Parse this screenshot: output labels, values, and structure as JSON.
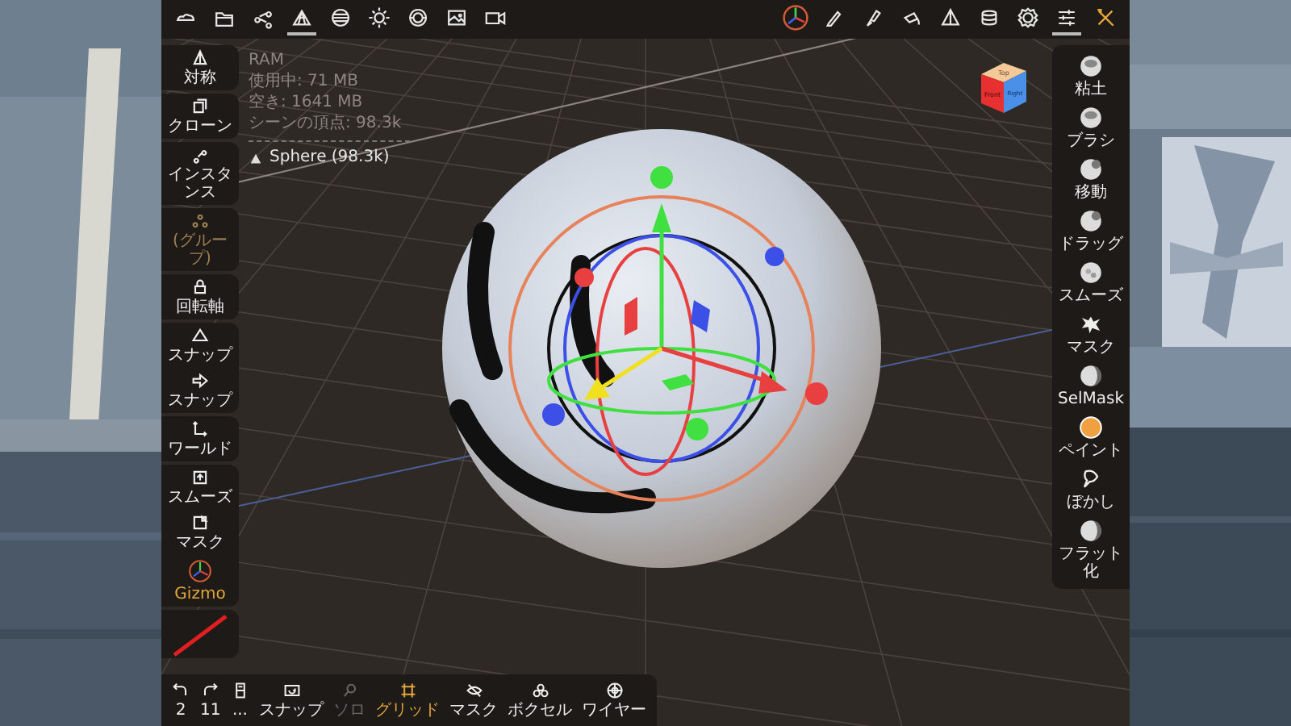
{
  "top_bar": {
    "left_icons": [
      {
        "selected": false
      },
      {
        "selected": false
      },
      {
        "selected": false
      },
      {
        "selected": true
      },
      {
        "selected": false
      },
      {
        "selected": false
      },
      {
        "selected": false
      },
      {
        "selected": false
      },
      {
        "selected": false
      }
    ],
    "right_icons": [
      {
        "selected": false,
        "highlighted": false
      },
      {
        "selected": false,
        "highlighted": false
      },
      {
        "selected": false,
        "highlighted": false
      },
      {
        "selected": false,
        "highlighted": false
      },
      {
        "selected": false,
        "highlighted": false
      },
      {
        "selected": false,
        "highlighted": false
      },
      {
        "selected": false,
        "highlighted": false
      },
      {
        "selected": true,
        "highlighted": false
      },
      {
        "selected": false,
        "highlighted": true
      }
    ]
  },
  "info": {
    "title": "RAM",
    "lines": [
      "使用中: 71 MB",
      "空き: 1641 MB",
      "シーンの頂点: 98.3k"
    ],
    "object": "Sphere (98.3k)"
  },
  "view_cube": {
    "top": "Top",
    "front": "Front",
    "right": "Right"
  },
  "left_toolbar": {
    "groups": [
      {
        "items": [
          {
            "label": "対称",
            "disabled": false,
            "highlighted": false
          }
        ]
      },
      {
        "items": [
          {
            "label": "クローン",
            "disabled": false,
            "highlighted": false
          }
        ]
      },
      {
        "items": [
          {
            "label": "インスタンス",
            "disabled": false,
            "highlighted": false
          }
        ]
      },
      {
        "items": [
          {
            "label": "(グループ)",
            "disabled": true,
            "highlighted": false
          }
        ]
      },
      {
        "items": [
          {
            "label": "回転軸",
            "disabled": false,
            "highlighted": false
          }
        ]
      },
      {
        "items": [
          {
            "label": "スナップ",
            "disabled": false,
            "highlighted": false
          },
          {
            "label": "スナップ",
            "disabled": false,
            "highlighted": false
          }
        ]
      },
      {
        "items": [
          {
            "label": "ワールド",
            "disabled": false,
            "highlighted": false
          }
        ]
      },
      {
        "items": [
          {
            "label": "スムーズ",
            "disabled": false,
            "highlighted": false
          },
          {
            "label": "マスク",
            "disabled": false,
            "highlighted": false
          },
          {
            "label": "Gizmo",
            "disabled": false,
            "highlighted": true
          }
        ]
      }
    ]
  },
  "right_toolbar": {
    "items": [
      {
        "label": "粘土"
      },
      {
        "label": "ブラシ"
      },
      {
        "label": "移動"
      },
      {
        "label": "ドラッグ"
      },
      {
        "label": "スムーズ"
      },
      {
        "label": "マスク"
      },
      {
        "label": "SelMask"
      },
      {
        "label": "ペイント"
      },
      {
        "label": "ぼかし"
      },
      {
        "label": "フラット化"
      }
    ]
  },
  "bottom_bar": {
    "items": [
      {
        "label": "2",
        "disabled": false,
        "active": false
      },
      {
        "label": "11",
        "disabled": false,
        "active": false
      },
      {
        "label": "...",
        "disabled": false,
        "active": false
      },
      {
        "label": "スナップ",
        "disabled": false,
        "active": false
      },
      {
        "label": "ソロ",
        "disabled": true,
        "active": false
      },
      {
        "label": "グリッド",
        "disabled": false,
        "active": true
      },
      {
        "label": "マスク",
        "disabled": false,
        "active": false
      },
      {
        "label": "ボクセル",
        "disabled": false,
        "active": false
      },
      {
        "label": "ワイヤー",
        "disabled": false,
        "active": false
      }
    ]
  }
}
